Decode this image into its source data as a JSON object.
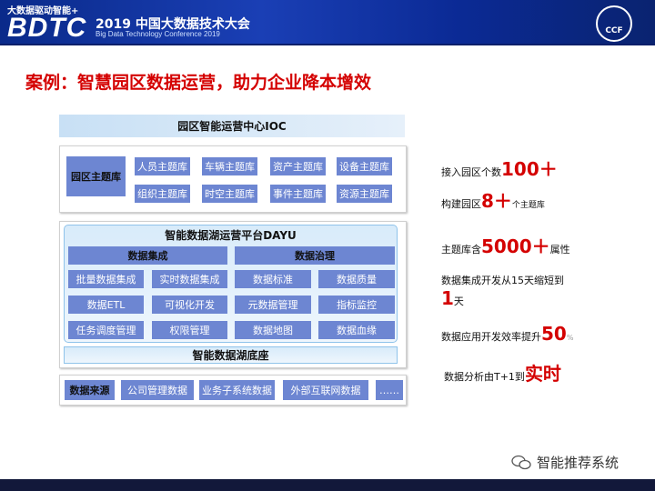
{
  "header": {
    "slogan": "大数据驱动智能+",
    "logo": "BDTC",
    "conference": "2019 中国大数据技术大会",
    "conference_en": "Big Data Technology Conference 2019",
    "org_logo": "CCF"
  },
  "title": "案例：智慧园区数据运营，助力企业降本增效",
  "ioc": "园区智能运营中心IOC",
  "themes": {
    "label": "园区主题库",
    "items": [
      "人员主题库",
      "车辆主题库",
      "资产主题库",
      "设备主题库",
      "组织主题库",
      "时空主题库",
      "事件主题库",
      "资源主题库"
    ]
  },
  "dayu": {
    "title": "智能数据湖运营平台DAYU",
    "integration": {
      "label": "数据集成",
      "items": [
        "批量数据集成",
        "实时数据集成",
        "数据ETL",
        "可视化开发",
        "任务调度管理",
        "权限管理"
      ]
    },
    "governance": {
      "label": "数据治理",
      "items": [
        "数据标准",
        "数据质量",
        "元数据管理",
        "指标监控",
        "数据地图",
        "数据血缘"
      ]
    },
    "base": "智能数据湖底座"
  },
  "sources": {
    "label": "数据来源",
    "items": [
      "公司管理数据",
      "业务子系统数据",
      "外部互联网数据",
      "……"
    ]
  },
  "stats": [
    {
      "pre": "接入园区个数",
      "big": "100＋",
      "post": ""
    },
    {
      "pre": "构建园区",
      "big": "8＋",
      "post": "个主题库"
    },
    {
      "pre": "主题库含",
      "big": "5000＋",
      "post": "属性"
    },
    {
      "pre": "数据集成开发从15天缩短到",
      "big": "1",
      "post": "天"
    },
    {
      "pre": "数据应用开发效率提升",
      "big": "50",
      "post": "%"
    },
    {
      "pre": "数据分析由T+1到",
      "big": "实时",
      "post": ""
    }
  ],
  "watermark": "智能推荐系统"
}
